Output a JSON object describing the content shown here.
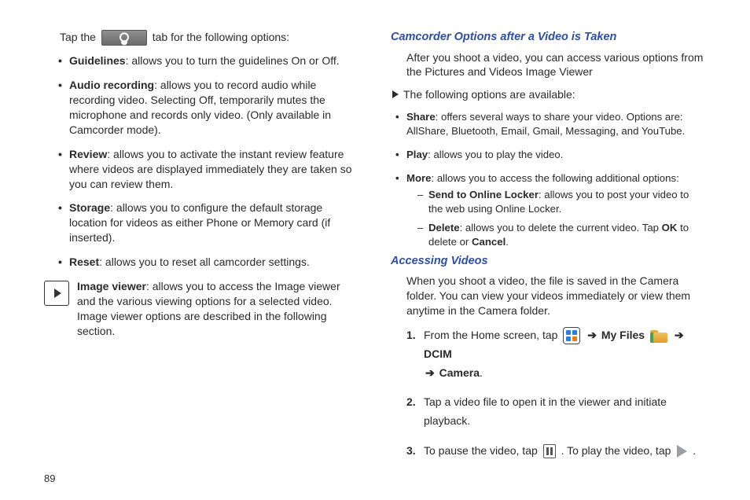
{
  "left": {
    "tap_pre": "Tap the ",
    "tap_post": " tab for the following options:",
    "opts": [
      {
        "b": "Guidelines",
        "t": ": allows you to turn the guidelines On or Off."
      },
      {
        "b": "Audio recording",
        "t": ": allows you to record audio while recording video. Selecting Off, temporarily mutes the microphone and records only video. (Only available in Camcorder mode)."
      },
      {
        "b": "Review",
        "t": ": allows you to activate the instant review feature where videos are displayed immediately they are taken so you can review them."
      },
      {
        "b": "Storage",
        "t": ": allows you to configure the default storage location for videos as either Phone or Memory card (if inserted)."
      },
      {
        "b": "Reset",
        "t": ": allows you to reset all camcorder settings."
      }
    ],
    "iv_b": "Image viewer",
    "iv_t": ": allows you to access the Image viewer and the various viewing options for a selected video. Image viewer options are described in the following section."
  },
  "right": {
    "h1": "Camcorder Options after a Video is Taken",
    "p1": "After you shoot a video, you can access various options from the Pictures and Videos Image Viewer",
    "arrow": "The following options are available:",
    "opts": [
      {
        "b": "Share",
        "t": ": offers several ways to share your video. Options are: AllShare, Bluetooth, Email, Gmail, Messaging, and YouTube."
      },
      {
        "b": "Play",
        "t": ": allows you to play the video."
      },
      {
        "b": "More",
        "t": ": allows you to access the following additional options:"
      }
    ],
    "sub": [
      {
        "b": "Send to Online Locker",
        "t": ": allows you to post your video to the web using Online Locker."
      },
      {
        "b": "Delete",
        "t1": ": allows you to delete the current video. Tap ",
        "ok": "OK",
        "t2": " to delete or ",
        "cancel": "Cancel",
        "t3": "."
      }
    ],
    "h2": "Accessing Videos",
    "p2": "When you shoot a video, the file is saved in the Camera folder. You can view your videos immediately or view them anytime in the Camera folder.",
    "steps": {
      "s1_a": "From the Home screen, tap ",
      "s1_myfiles": "My Files",
      "s1_dcim": "DCIM",
      "s1_camera": "Camera",
      "arrow": "➔",
      "s2": "Tap a video file to open it in the viewer and initiate playback.",
      "s3_a": "To pause the video, tap ",
      "s3_b": ". To play the video, tap ",
      "s3_c": "."
    }
  },
  "page": "89"
}
